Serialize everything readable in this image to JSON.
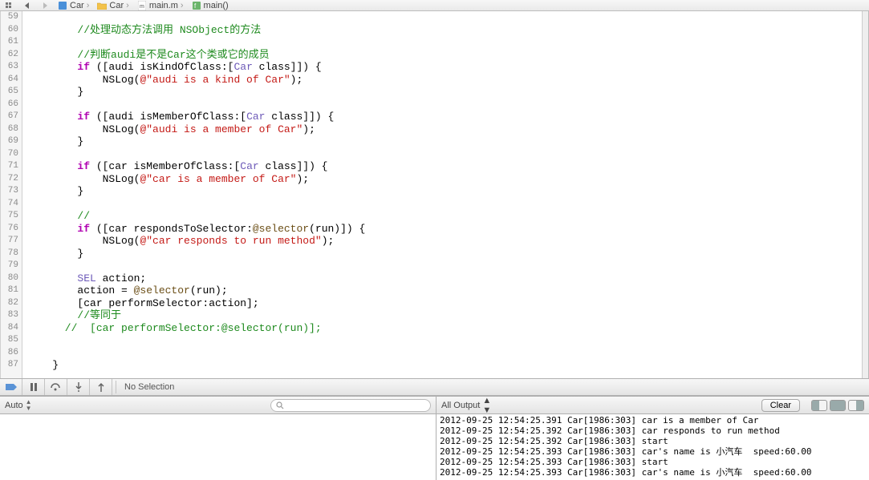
{
  "topbar": {
    "breadcrumb": {
      "proj": "Car",
      "folder": "Car",
      "file": "main.m",
      "symbol": "main()"
    }
  },
  "editor": {
    "lines": [
      {
        "n": 59,
        "s": ""
      },
      {
        "n": 60,
        "s": "        //处理动态方法调用 NSObject的方法",
        "cls": "cm"
      },
      {
        "n": 61,
        "s": ""
      },
      {
        "n": 62,
        "s": "        //判断audi是不是Car这个类或它的成员",
        "cls": "cm"
      },
      {
        "n": 63,
        "s": "        if ([audi isKindOfClass:[Car class]]) {",
        "seg": [
          [
            "        ",
            ""
          ],
          [
            "if",
            "kw"
          ],
          [
            " ([audi isKindOfClass:[",
            ""
          ],
          [
            "Car",
            "cls"
          ],
          [
            " class]]) {",
            ""
          ]
        ]
      },
      {
        "n": 64,
        "s": "            NSLog(@\"audi is a kind of Car\");",
        "seg": [
          [
            "            NSLog(",
            ""
          ],
          [
            "@\"audi is a kind of Car\"",
            "str"
          ],
          [
            ");",
            ""
          ]
        ]
      },
      {
        "n": 65,
        "s": "        }"
      },
      {
        "n": 66,
        "s": ""
      },
      {
        "n": 67,
        "s": "        if ([audi isMemberOfClass:[Car class]]) {",
        "seg": [
          [
            "        ",
            ""
          ],
          [
            "if",
            "kw"
          ],
          [
            " ([audi isMemberOfClass:[",
            ""
          ],
          [
            "Car",
            "cls"
          ],
          [
            " class]]) {",
            ""
          ]
        ]
      },
      {
        "n": 68,
        "s": "            NSLog(@\"audi is a member of Car\");",
        "seg": [
          [
            "            NSLog(",
            ""
          ],
          [
            "@\"audi is a member of Car\"",
            "str"
          ],
          [
            ");",
            ""
          ]
        ]
      },
      {
        "n": 69,
        "s": "        }"
      },
      {
        "n": 70,
        "s": ""
      },
      {
        "n": 71,
        "s": "        if ([car isMemberOfClass:[Car class]]) {",
        "seg": [
          [
            "        ",
            ""
          ],
          [
            "if",
            "kw"
          ],
          [
            " ([car isMemberOfClass:[",
            ""
          ],
          [
            "Car",
            "cls"
          ],
          [
            " class]]) {",
            ""
          ]
        ]
      },
      {
        "n": 72,
        "s": "            NSLog(@\"car is a member of Car\");",
        "seg": [
          [
            "            NSLog(",
            ""
          ],
          [
            "@\"car is a member of Car\"",
            "str"
          ],
          [
            ");",
            ""
          ]
        ]
      },
      {
        "n": 73,
        "s": "        }"
      },
      {
        "n": 74,
        "s": ""
      },
      {
        "n": 75,
        "s": "        //",
        "cls": "cm"
      },
      {
        "n": 76,
        "s": "        if ([car respondsToSelector:@selector(run)]) {",
        "seg": [
          [
            "        ",
            ""
          ],
          [
            "if",
            "kw"
          ],
          [
            " ([car respondsToSelector:",
            ""
          ],
          [
            "@selector",
            "sel"
          ],
          [
            "(run)]) {",
            ""
          ]
        ]
      },
      {
        "n": 77,
        "s": "            NSLog(@\"car responds to run method\");",
        "seg": [
          [
            "            NSLog(",
            ""
          ],
          [
            "@\"car responds to run method\"",
            "str"
          ],
          [
            ");",
            ""
          ]
        ]
      },
      {
        "n": 78,
        "s": "        }"
      },
      {
        "n": 79,
        "s": ""
      },
      {
        "n": 80,
        "s": "        SEL action;",
        "seg": [
          [
            "        ",
            ""
          ],
          [
            "SEL",
            "cls"
          ],
          [
            " action;",
            ""
          ]
        ]
      },
      {
        "n": 81,
        "s": "        action = @selector(run);",
        "seg": [
          [
            "        action = ",
            ""
          ],
          [
            "@selector",
            "sel"
          ],
          [
            "(run);",
            ""
          ]
        ]
      },
      {
        "n": 82,
        "s": "        [car performSelector:action];"
      },
      {
        "n": 83,
        "s": "        //等同于",
        "cls": "cm"
      },
      {
        "n": 84,
        "s": "      //  [car performSelector:@selector(run)];",
        "cls": "cm"
      },
      {
        "n": 85,
        "s": ""
      },
      {
        "n": 86,
        "s": ""
      },
      {
        "n": 87,
        "s": "    }"
      }
    ]
  },
  "debugbar": {
    "status": "No Selection"
  },
  "variables": {
    "scope_label": "Auto"
  },
  "console": {
    "filter_label": "All Output",
    "clear_label": "Clear",
    "lines": [
      "2012-09-25 12:54:25.391 Car[1986:303] car is a member of Car",
      "2012-09-25 12:54:25.392 Car[1986:303] car responds to run method",
      "2012-09-25 12:54:25.392 Car[1986:303] start",
      "2012-09-25 12:54:25.393 Car[1986:303] car's name is 小汽车  speed:60.00",
      "2012-09-25 12:54:25.393 Car[1986:303] start",
      "2012-09-25 12:54:25.393 Car[1986:303] car's name is 小汽车  speed:60.00"
    ]
  }
}
